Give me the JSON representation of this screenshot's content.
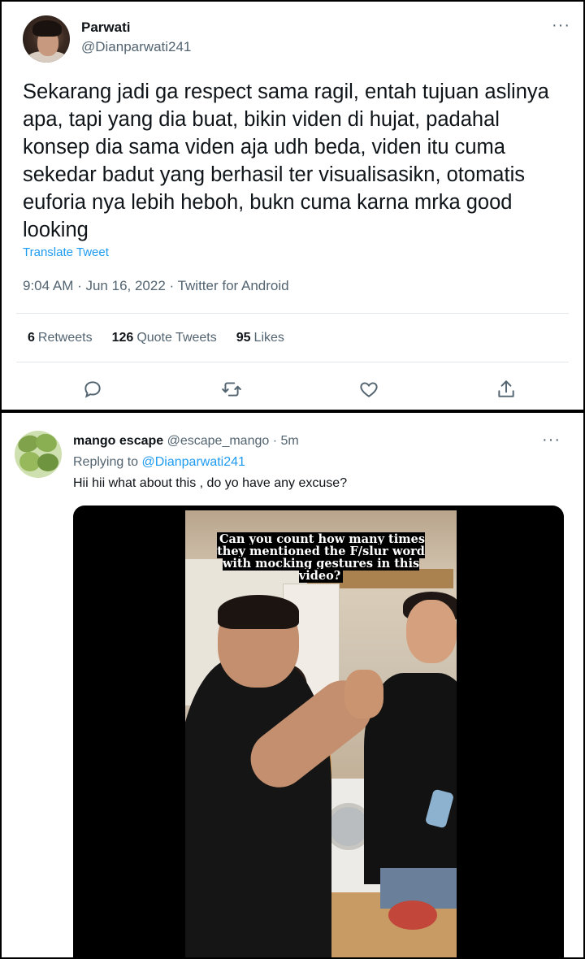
{
  "top_tweet": {
    "name": "Parwati",
    "handle": "@Dianparwati241",
    "more": "···",
    "text": "Sekarang jadi ga respect sama ragil, entah tujuan aslinya apa, tapi yang dia buat, bikin viden di hujat, padahal konsep dia sama viden aja udh beda, viden itu cuma sekedar badut yang berhasil ter visualisasikn, otomatis euforia nya lebih heboh, bukn cuma karna mrka good looking",
    "translate": "Translate Tweet",
    "meta": "9:04 AM · Jun 16, 2022 · Twitter for Android",
    "stats": [
      {
        "count": "6",
        "label": "Retweets"
      },
      {
        "count": "126",
        "label": "Quote Tweets"
      },
      {
        "count": "95",
        "label": "Likes"
      }
    ],
    "actions": [
      "reply-icon",
      "retweet-icon",
      "like-icon",
      "share-icon"
    ]
  },
  "reply_tweet": {
    "name": "mango escape",
    "handle_time": "@escape_mango · 5m",
    "more": "···",
    "replying_prefix": "Replying to",
    "replying_mention": "@Dianparwati241",
    "text": "Hii hii what about this , do yo have any excuse?",
    "video_caption": "Can you count how many times they mentioned the F/slur word with mocking gestures in this video?"
  },
  "colors": {
    "text": "#0f1419",
    "secondary": "#536471",
    "link": "#1d9bf0",
    "divider": "#e1e8ed"
  }
}
